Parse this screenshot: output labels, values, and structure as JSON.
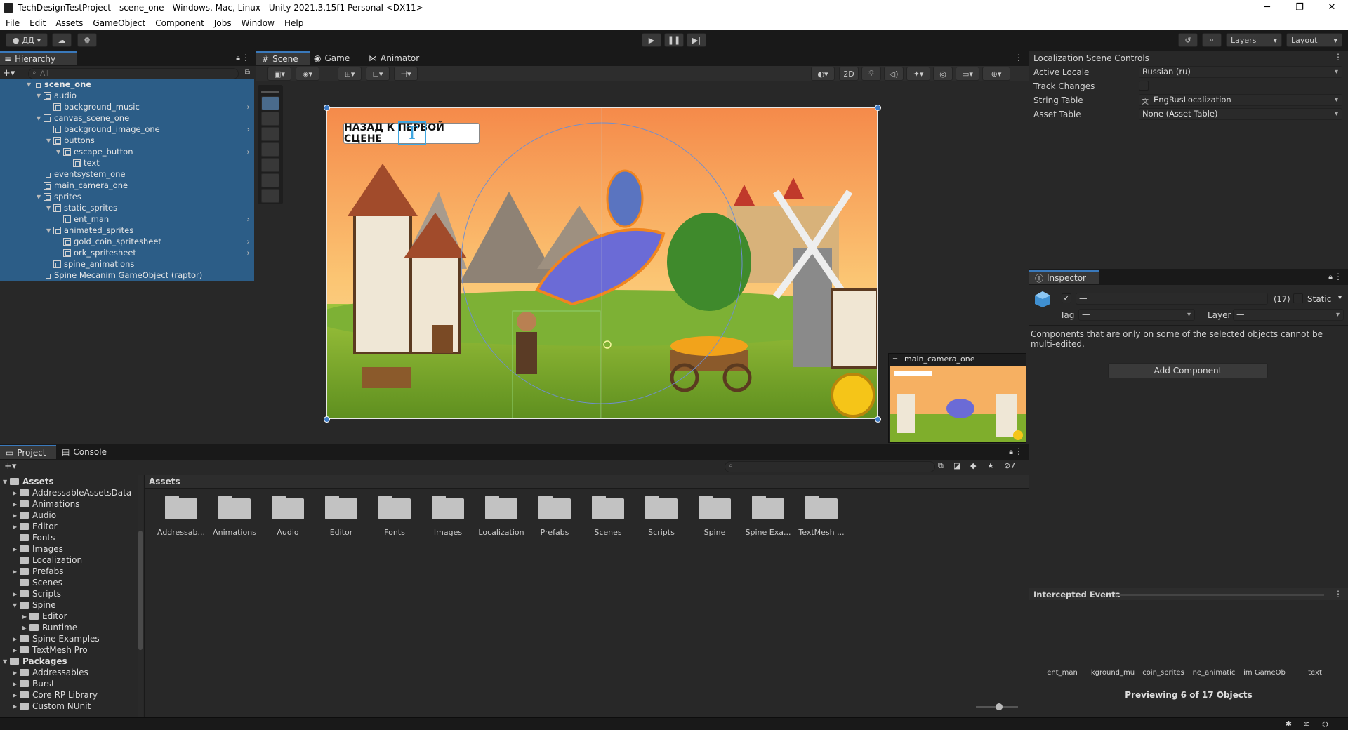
{
  "window": {
    "title": "TechDesignTestProject - scene_one - Windows, Mac, Linux - Unity 2021.3.15f1 Personal <DX11>",
    "controls": [
      "─",
      "❐",
      "✕"
    ]
  },
  "menu": [
    "File",
    "Edit",
    "Assets",
    "GameObject",
    "Component",
    "Jobs",
    "Window",
    "Help"
  ],
  "toolbar": {
    "account": "ДД",
    "layers": "Layers",
    "layout": "Layout"
  },
  "hierarchy": {
    "tab": "Hierarchy",
    "search_placeholder": "All",
    "rows": [
      {
        "label": "scene_one",
        "indent": 0,
        "arrow": "▼",
        "sel": true,
        "bold": true
      },
      {
        "label": "audio",
        "indent": 1,
        "arrow": "▼",
        "sel": true
      },
      {
        "label": "background_music",
        "indent": 2,
        "arrow": "",
        "sel": true
      },
      {
        "label": "canvas_scene_one",
        "indent": 1,
        "arrow": "▼",
        "sel": true
      },
      {
        "label": "background_image_one",
        "indent": 2,
        "arrow": "",
        "sel": true
      },
      {
        "label": "buttons",
        "indent": 2,
        "arrow": "▼",
        "sel": true
      },
      {
        "label": "escape_button",
        "indent": 3,
        "arrow": "▼",
        "sel": true
      },
      {
        "label": "text",
        "indent": 4,
        "arrow": "",
        "sel": true
      },
      {
        "label": "eventsystem_one",
        "indent": 1,
        "arrow": "",
        "sel": true
      },
      {
        "label": "main_camera_one",
        "indent": 1,
        "arrow": "",
        "sel": true
      },
      {
        "label": "sprites",
        "indent": 1,
        "arrow": "▼",
        "sel": true
      },
      {
        "label": "static_sprites",
        "indent": 2,
        "arrow": "▼",
        "sel": true
      },
      {
        "label": "ent_man",
        "indent": 3,
        "arrow": "",
        "sel": true
      },
      {
        "label": "animated_sprites",
        "indent": 2,
        "arrow": "▼",
        "sel": true
      },
      {
        "label": "gold_coin_spritesheet",
        "indent": 3,
        "arrow": "",
        "sel": true
      },
      {
        "label": "ork_spritesheet",
        "indent": 3,
        "arrow": "",
        "sel": true
      },
      {
        "label": "spine_animations",
        "indent": 2,
        "arrow": "",
        "sel": true
      },
      {
        "label": "Spine Mecanim GameObject (raptor)",
        "indent": 1,
        "arrow": "",
        "sel": true
      }
    ]
  },
  "scene": {
    "tabs": [
      "Scene",
      "Game",
      "Animator"
    ],
    "mode_2d": "2D",
    "button_text": "НАЗАД К ПЕРВОЙ СЦЕНЕ",
    "camera_preview_title": "main_camera_one"
  },
  "localization": {
    "title": "Localization Scene Controls",
    "fields": [
      {
        "label": "Active Locale",
        "value": "Russian (ru)"
      },
      {
        "label": "Track Changes",
        "value": ""
      },
      {
        "label": "String Table",
        "value": "EngRusLocalization"
      },
      {
        "label": "Asset Table",
        "value": "None (Asset Table)"
      }
    ]
  },
  "inspector": {
    "tab": "Inspector",
    "name_value": "—",
    "count": "(17)",
    "static_label": "Static",
    "tag_label": "Tag",
    "tag_value": "—",
    "layer_label": "Layer",
    "layer_value": "—",
    "message": "Components that are only on some of the selected objects cannot be multi-edited.",
    "add_component": "Add Component",
    "intercepted": "Intercepted Events",
    "previews": [
      "ent_man",
      "kground_mu",
      "coin_sprites",
      "ne_animatic",
      "im GameOb",
      "text"
    ],
    "preview_status": "Previewing 6 of 17 Objects"
  },
  "project": {
    "tabs": [
      "Project",
      "Console"
    ],
    "breadcrumb": "Assets",
    "hidden_count": "7",
    "tree": [
      {
        "label": "Assets",
        "indent": 0,
        "arrow": "▼",
        "bold": true
      },
      {
        "label": "AddressableAssetsData",
        "indent": 1,
        "arrow": "▶"
      },
      {
        "label": "Animations",
        "indent": 1,
        "arrow": "▶"
      },
      {
        "label": "Audio",
        "indent": 1,
        "arrow": "▶"
      },
      {
        "label": "Editor",
        "indent": 1,
        "arrow": "▶"
      },
      {
        "label": "Fonts",
        "indent": 1,
        "arrow": ""
      },
      {
        "label": "Images",
        "indent": 1,
        "arrow": "▶"
      },
      {
        "label": "Localization",
        "indent": 1,
        "arrow": ""
      },
      {
        "label": "Prefabs",
        "indent": 1,
        "arrow": "▶"
      },
      {
        "label": "Scenes",
        "indent": 1,
        "arrow": ""
      },
      {
        "label": "Scripts",
        "indent": 1,
        "arrow": "▶"
      },
      {
        "label": "Spine",
        "indent": 1,
        "arrow": "▼"
      },
      {
        "label": "Editor",
        "indent": 2,
        "arrow": "▶"
      },
      {
        "label": "Runtime",
        "indent": 2,
        "arrow": "▶"
      },
      {
        "label": "Spine Examples",
        "indent": 1,
        "arrow": "▶"
      },
      {
        "label": "TextMesh Pro",
        "indent": 1,
        "arrow": "▶"
      },
      {
        "label": "Packages",
        "indent": 0,
        "arrow": "▼",
        "bold": true
      },
      {
        "label": "Addressables",
        "indent": 1,
        "arrow": "▶"
      },
      {
        "label": "Burst",
        "indent": 1,
        "arrow": "▶"
      },
      {
        "label": "Core RP Library",
        "indent": 1,
        "arrow": "▶"
      },
      {
        "label": "Custom NUnit",
        "indent": 1,
        "arrow": "▶"
      }
    ],
    "folders": [
      "Addressab...",
      "Animations",
      "Audio",
      "Editor",
      "Fonts",
      "Images",
      "Localization",
      "Prefabs",
      "Scenes",
      "Scripts",
      "Spine",
      "Spine Exa...",
      "TextMesh ..."
    ]
  }
}
